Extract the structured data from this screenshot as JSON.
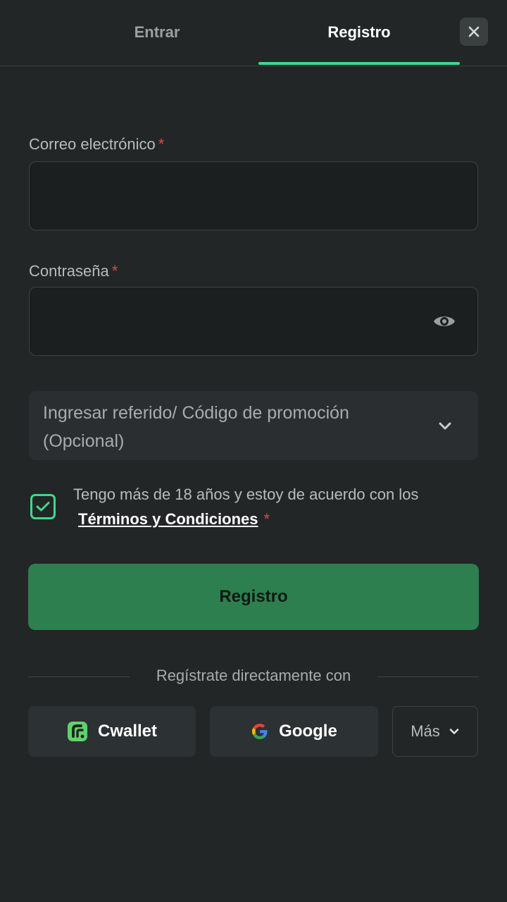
{
  "tabs": {
    "login_label": "Entrar",
    "register_label": "Registro"
  },
  "form": {
    "email_label": "Correo electrónico",
    "password_label": "Contraseña",
    "required_mark": "*",
    "email_value": "",
    "password_value": "",
    "promo_label": "Ingresar referido/ Código de promoción (Opcional)"
  },
  "terms": {
    "text": "Tengo más de 18 años y estoy de acuerdo con los",
    "link_text": "Términos y Condiciones",
    "required_mark": "*",
    "checked": true
  },
  "register_button_label": "Registro",
  "social": {
    "divider_text": "Regístrate directamente con",
    "cwallet_label": "Cwallet",
    "google_label": "Google",
    "more_label": "Más"
  },
  "colors": {
    "background": "#232626",
    "accent": "#3fd98a",
    "primary_button": "#2d7f4f",
    "required": "#e04747"
  },
  "icons": [
    "close-icon",
    "eye-icon",
    "chevron-down-icon",
    "checkmark-icon",
    "cwallet-icon",
    "google-icon"
  ]
}
